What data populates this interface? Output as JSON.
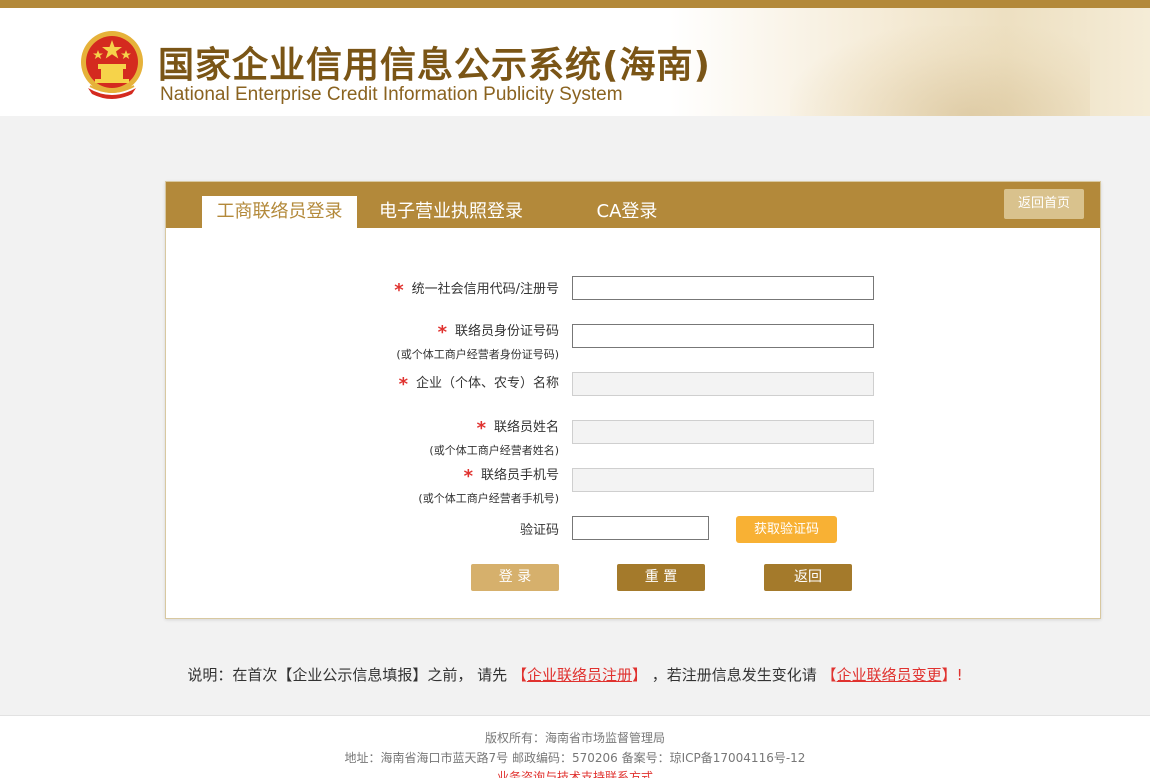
{
  "header": {
    "title_cn": "国家企业信用信息公示系统(海南)",
    "title_en": "National Enterprise Credit Information Publicity System",
    "emblem_icon": "national-emblem-icon"
  },
  "tabs": [
    {
      "label": "工商联络员登录",
      "active": true
    },
    {
      "label": "电子营业执照登录",
      "active": false
    },
    {
      "label": "CA登录",
      "active": false
    }
  ],
  "home_button": "返回首页",
  "form": {
    "required_mark": "*",
    "credit_code_label": "统一社会信用代码/注册号",
    "id_label": "联络员身份证号码",
    "id_sublabel": "(或个体工商户经营者身份证号码)",
    "company_label": "企业（个体、农专）名称",
    "name_label": "联络员姓名",
    "name_sublabel": "(或个体工商户经营者姓名)",
    "phone_label": "联络员手机号",
    "phone_sublabel": "(或个体工商户经营者手机号)",
    "captcha_label": "验证码",
    "get_code_button": "获取验证码",
    "login_button": "登 录",
    "reset_button": "重 置",
    "back_button": "返回"
  },
  "note": {
    "prefix": "说明：在首次【企业公示信息填报】之前， 请先 ",
    "register_open": "【",
    "register_link": "企业联络员注册",
    "register_close": "】",
    "middle": " ，若注册信息发生变化请 ",
    "change_open": "【",
    "change_link": "企业联络员变更",
    "change_close": "】!"
  },
  "footer": {
    "copyright": "版权所有：海南省市场监督管理局",
    "address": "地址：海南省海口市蓝天路7号 邮政编码：570206 备案号：琼ICP备17004116号-12",
    "support": "业务咨询与技术支持联系方式"
  },
  "colors": {
    "accent": "#b3893a",
    "brand_text": "#7a5516",
    "required": "#e0322f",
    "get_code": "#f8b134"
  }
}
